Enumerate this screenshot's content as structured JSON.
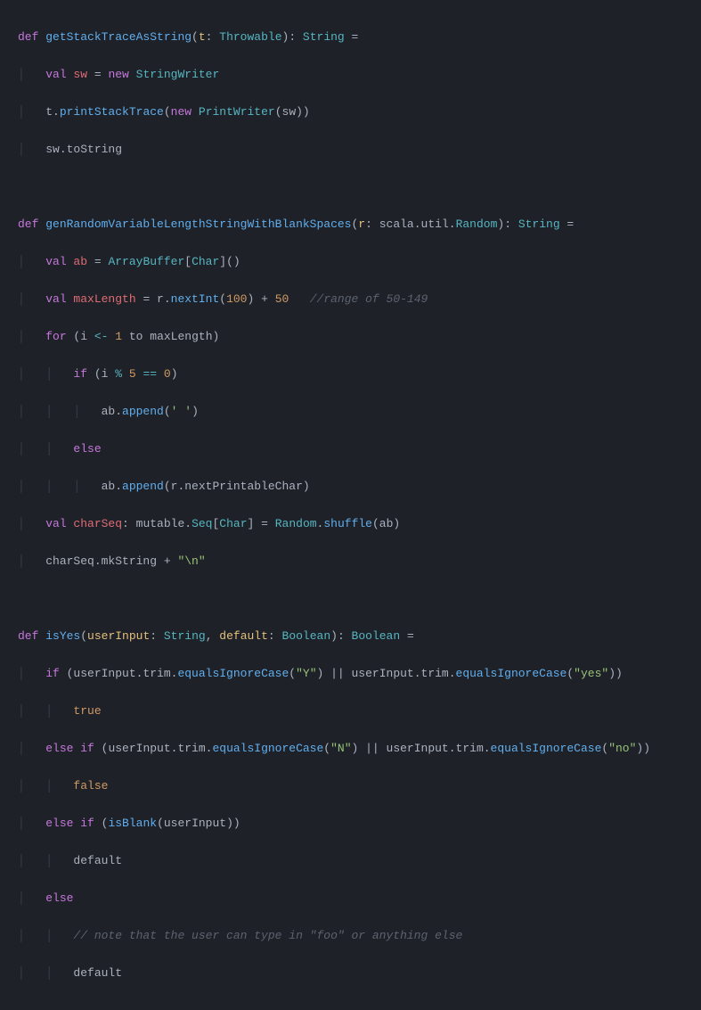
{
  "code": {
    "fn1": {
      "def": "def",
      "name": "getStackTraceAsString",
      "lp": "(",
      "p1": "t",
      "colon1": ": ",
      "type1": "Throwable",
      "rp": ")",
      "colon2": ": ",
      "rettype": "String",
      "eq": " =",
      "l2_val": "val",
      "l2_sw": " sw",
      "l2_eq": " = ",
      "l2_new": "new",
      "l2_sp": " ",
      "l2_type": "StringWriter",
      "l3_t": "t.",
      "l3_fn": "printStackTrace",
      "l3_lp": "(",
      "l3_new": "new",
      "l3_sp": " ",
      "l3_type": "PrintWriter",
      "l3_args": "(sw))",
      "l4": "sw.toString"
    },
    "fn2": {
      "def": "def",
      "name": "genRandomVariableLengthStringWithBlankSpaces",
      "lp": "(",
      "p1": "r",
      "colon1": ": ",
      "type1a": "scala",
      "dot1": ".",
      "type1b": "util",
      "dot2": ".",
      "type1c": "Random",
      "rp": ")",
      "colon2": ": ",
      "rettype": "String",
      "eq": " =",
      "l2_val": "val",
      "l2_ab": " ab",
      "l2_eq": " = ",
      "l2_type": "ArrayBuffer",
      "l2_lb": "[",
      "l2_char": "Char",
      "l2_rb": "]()",
      "l3_val": "val",
      "l3_ml": " maxLength",
      "l3_eq": " = r.",
      "l3_fn": "nextInt",
      "l3_lp": "(",
      "l3_n100": "100",
      "l3_rp": ") + ",
      "l3_n50": "50",
      "l3_sp": "   ",
      "l3_cm": "//range of 50-149",
      "l4_for": "for",
      "l4_rest1": " (i ",
      "l4_arrow": "<-",
      "l4_sp1": " ",
      "l4_n1": "1",
      "l4_to": " to maxLength)",
      "l5_if": "if",
      "l5_rest1": " (i ",
      "l5_mod": "%",
      "l5_sp1": " ",
      "l5_n5": "5",
      "l5_sp2": " ",
      "l5_eqeq": "==",
      "l5_sp3": " ",
      "l5_n0": "0",
      "l5_rp": ")",
      "l6_pre": "ab.",
      "l6_fn": "append",
      "l6_lp": "(",
      "l6_str": "' '",
      "l6_rp": ")",
      "l7_else": "else",
      "l8_pre": "ab.",
      "l8_fn": "append",
      "l8_args": "(r.nextPrintableChar)",
      "l9_val": "val",
      "l9_cs": " charSeq",
      "l9_colon": ": ",
      "l9_mut": "mutable",
      "l9_dot": ".",
      "l9_seq": "Seq",
      "l9_lb": "[",
      "l9_char": "Char",
      "l9_rb": "] = ",
      "l9_rand": "Random",
      "l9_dot2": ".",
      "l9_shuf": "shuffle",
      "l9_args": "(ab)",
      "l10_pre": "charSeq.mkString + ",
      "l10_str": "\"\\n\""
    },
    "fn3": {
      "def": "def",
      "name": "isYes",
      "lp": "(",
      "p1": "userInput",
      "c1": ": ",
      "t1": "String",
      "comma": ", ",
      "p2": "default",
      "c2": ": ",
      "t2": "Boolean",
      "rp": ")",
      "c3": ": ",
      "rt": "Boolean",
      "eq": " =",
      "l2_if": "if",
      "l2_a": " (userInput.trim.",
      "l2_fn1": "equalsIgnoreCase",
      "l2_lp1": "(",
      "l2_s1": "\"Y\"",
      "l2_rp1": ") || userInput.trim.",
      "l2_fn2": "equalsIgnoreCase",
      "l2_lp2": "(",
      "l2_s2": "\"yes\"",
      "l2_rp2": "))",
      "l3_true": "true",
      "l4_else": "else",
      "l4_if": " if",
      "l4_a": " (userInput.trim.",
      "l4_fn1": "equalsIgnoreCase",
      "l4_lp1": "(",
      "l4_s1": "\"N\"",
      "l4_rp1": ") || userInput.trim.",
      "l4_fn2": "equalsIgnoreCase",
      "l4_lp2": "(",
      "l4_s2": "\"no\"",
      "l4_rp2": "))",
      "l5_false": "false",
      "l6_else": "else",
      "l6_if": " if",
      "l6_a": " (",
      "l6_fn": "isBlank",
      "l6_args": "(userInput))",
      "l7_default": "default",
      "l8_else": "else",
      "l9_cm": "// note that the user can type in \"foo\" or anything else",
      "l10_default": "default"
    }
  }
}
